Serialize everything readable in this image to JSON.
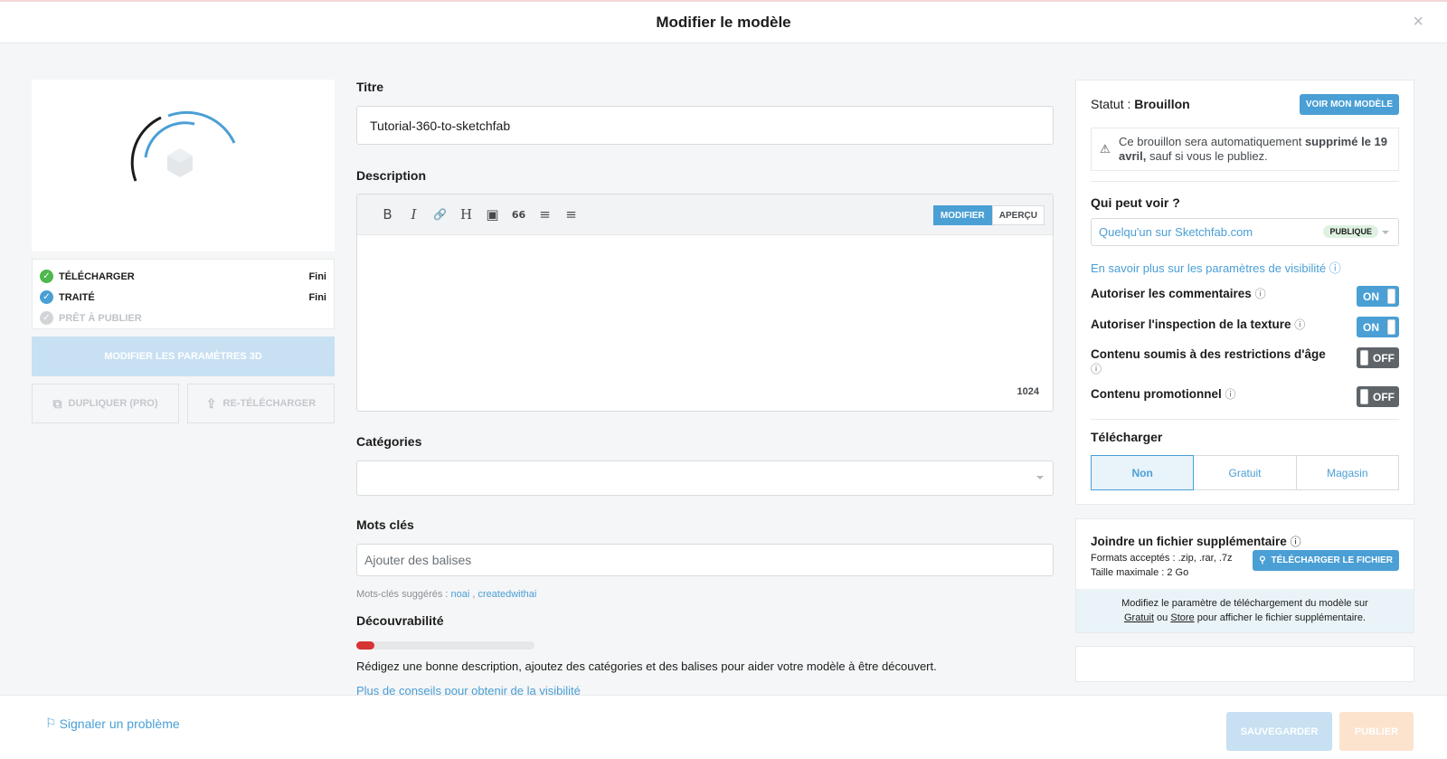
{
  "header": {
    "title": "Modifier le modèle",
    "close_icon": "×"
  },
  "left": {
    "steps": [
      {
        "label": "Télécharger",
        "value": "Fini",
        "icon": "check-icon"
      },
      {
        "label": "Traité",
        "value": "Fini",
        "icon": "check-icon"
      },
      {
        "label": "Prêt à publier",
        "value": "",
        "icon": "check-icon"
      }
    ],
    "edit_3d_label": "Modifier les paramètres 3D",
    "duplicate_label": "Dupliquer (PRO)",
    "reupload_label": "Re-télécharger"
  },
  "mid": {
    "title_label": "Titre",
    "title_value": "Tutorial-360-to-sketchfab",
    "description_label": "Description",
    "toolbar": {
      "bold": "B",
      "italic": "I",
      "link": "🔗",
      "heading": "H",
      "image": "▣",
      "quote": "66",
      "ol": "≡",
      "ul": "≡"
    },
    "modify_label": "Modifier",
    "preview_label": "Aperçu",
    "char_counter": "1024",
    "categories_label": "Catégories",
    "keywords_label": "Mots clés",
    "keywords_placeholder": "Ajouter des balises",
    "suggested_prefix": "Mots-clés suggérés : ",
    "suggested_1": "noai",
    "suggested_sep": " , ",
    "suggested_2": "createdwithai",
    "discoverability_label": "Découvrabilité",
    "discoverability_level": 0.1,
    "discoverability_text": "Rédigez une bonne description, ajoutez des catégories et des balises pour aider votre modèle à être découvert.",
    "visibility_tips": "Plus de conseils pour obtenir de la visibilité"
  },
  "right": {
    "status_prefix": "Statut : ",
    "status_value": "Brouillon",
    "view_model_label": "Voir mon modèle",
    "notice_1": "Ce brouillon sera automatiquement ",
    "notice_2": "supprimé le 19 avril,",
    "notice_3": " sauf si vous le publiez.",
    "who_label": "Qui peut voir ?",
    "who_value": "Quelqu'un sur Sketchfab.com",
    "who_badge": "Publique",
    "learn_more": "En savoir plus sur les paramètres de visibilité",
    "toggles": [
      {
        "label": "Autoriser les commentaires",
        "state": "ON"
      },
      {
        "label": "Autoriser l'inspection de la texture",
        "state": "ON"
      },
      {
        "label": "Contenu soumis à des restrictions d'âge",
        "state": "OFF"
      },
      {
        "label": "Contenu promotionnel",
        "state": "OFF"
      }
    ],
    "download_label": "Télécharger",
    "download_options": [
      "Non",
      "Gratuit",
      "Magasin"
    ],
    "attach_title": "Joindre un fichier supplémentaire",
    "formats": "Formats acceptés : .zip, .rar, .7z",
    "max_size": "Taille maximale : 2 Go",
    "upload_file_label": "Télécharger le fichier",
    "info_1": "Modifiez le paramètre de téléchargement du modèle sur",
    "info_free": "Gratuit",
    "info_or": " ou ",
    "info_store": "Store",
    "info_2": " pour afficher le fichier supplémentaire."
  },
  "footer": {
    "report_label": "Signaler un problème",
    "save_label": "Sauvegarder",
    "publish_label": "Publier"
  },
  "colors": {
    "accent": "#4a9fd5",
    "success": "#4db84d",
    "danger": "#d63333"
  }
}
